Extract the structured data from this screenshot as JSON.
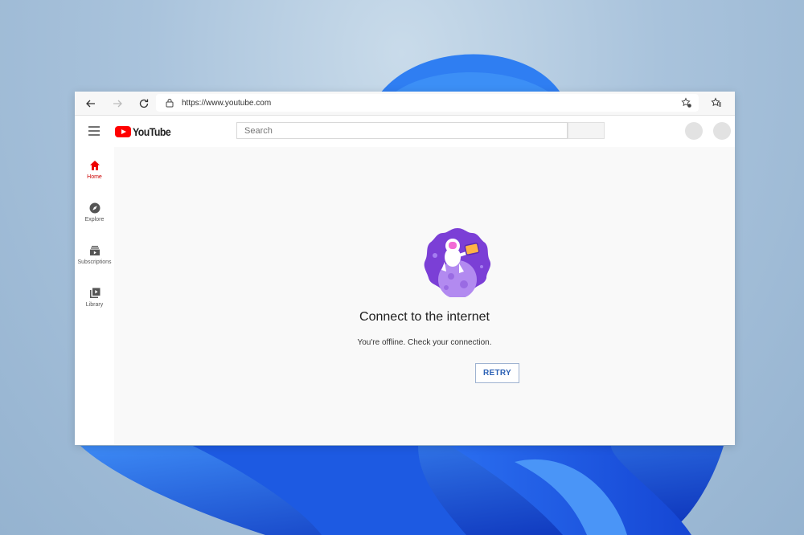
{
  "browser": {
    "url": "https://www.youtube.com",
    "icons": [
      "back-icon",
      "forward-icon",
      "refresh-icon",
      "lock-icon",
      "add-favorite-icon",
      "favorites-icon"
    ]
  },
  "youtube": {
    "logo_text": "YouTube",
    "search_placeholder": "Search",
    "sidebar": [
      {
        "label": "Home",
        "icon": "home-icon",
        "active": true
      },
      {
        "label": "Explore",
        "icon": "compass-icon",
        "active": false
      },
      {
        "label": "Subscriptions",
        "icon": "subscriptions-icon",
        "active": false
      },
      {
        "label": "Library",
        "icon": "library-icon",
        "active": false
      }
    ],
    "offline": {
      "title": "Connect to the internet",
      "message": "You're offline. Check your connection.",
      "retry_label": "RETRY"
    }
  },
  "colors": {
    "brand_red": "#ff0000",
    "active_red": "#cc0000",
    "retry_blue": "#2d62b5",
    "illustration_purple": "#7b3fd6"
  }
}
